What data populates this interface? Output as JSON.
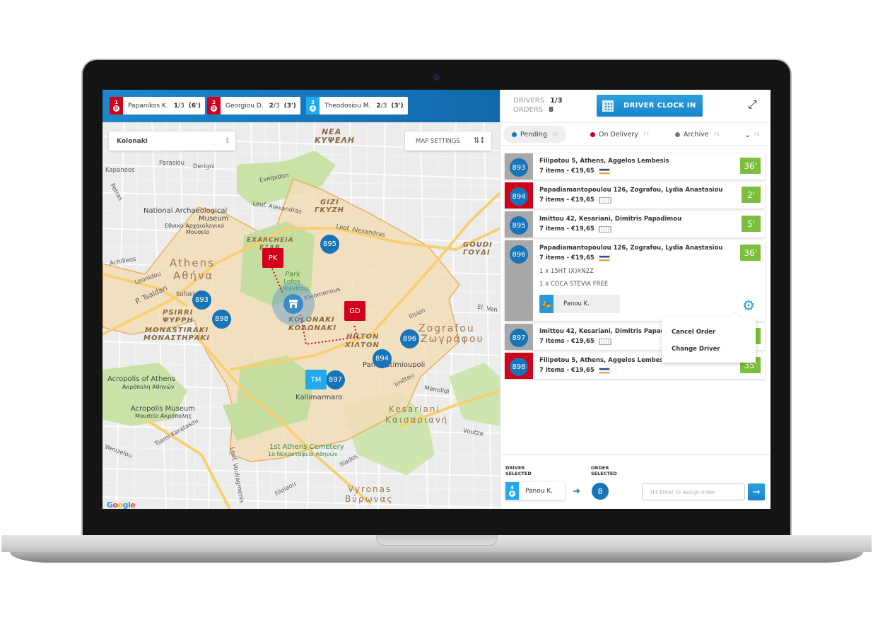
{
  "topbar": {
    "drivers": [
      {
        "index": "1",
        "status": "D",
        "name": "Papanikos K.",
        "count_done": "1",
        "count_total": "/3",
        "time": "(6')",
        "color": "#d0021b"
      },
      {
        "index": "2",
        "status": "D",
        "name": "Georgiou D.",
        "count_done": "2",
        "count_total": "/3",
        "time": "(3')",
        "color": "#d0021b"
      },
      {
        "index": "3",
        "status": "A",
        "name": "Theodosiou M.",
        "count_done": "2",
        "count_total": "/3",
        "time": "(3')",
        "color": "#22aaee"
      }
    ]
  },
  "map": {
    "area_select": "Kolonaki",
    "settings_label": "MAP SETTINGS",
    "labels": {
      "nea_kypseli": "ΝΕΑ",
      "nea_kypseli2": "ΚΥΨΕΛΗ",
      "gizi": "GIZI",
      "gizi_gr": "ΓΚΥΖΗ",
      "exarcheia": "EXARCHEIA",
      "exarcheia_gr": "ΕΞΑΡ",
      "athens": "Athens",
      "athens_gr": "Αθήνα",
      "psirri": "PSIRRI",
      "psirri_gr": "ΨΥΡΡΗ",
      "monastiraki": "MONASTIRAKI",
      "monastiraki_gr": "ΜΟΝΑΣΤΗΡΑΚΙ",
      "kolonaki": "KOLONAKI",
      "kolonaki_gr": "ΚΟΛΩΝΑΚΙ",
      "hilton": "HILTON",
      "hilton_gr": "ΧΙΛΤΟΝ",
      "zografou": "Zografou",
      "zografou_gr": "Ζωγράφου",
      "goudi": "GOUDI",
      "goudi_gr": "ΓΟΥΔΙ",
      "kesariani": "Kesariani",
      "kesariani_gr": "Καισαριανή",
      "vyronas": "Vyronas",
      "vyronas_gr": "Βύρωνας",
      "park": "Park",
      "park2": "Lofos",
      "park3": "Likavitou",
      "museum": "National Archaeological",
      "museum2": "Museum",
      "museum_gr": "Εθνικό Αρχαιολογικό",
      "museum_gr2": "Μουσείο",
      "acropolis": "Acropolis of Athens",
      "acropolis_gr": "Ακρόπολη Αθηνών",
      "acropolis_museum": "Acropolis Museum",
      "acropolis_museum_gr": "Μουσείο Ακρόπολης",
      "kallimarmaro": "Kallimarmaro",
      "cemetery": "1st Athens Cemetery",
      "cemetery_gr": "1ο Νεκροταφείο Αθηνών",
      "panepistimioupoli": "Panepistimioupoli",
      "evelpidon": "Evelpidon",
      "parasiou": "Parasiou",
      "derigni": "Derigni",
      "kapaneos": "Kapaneos",
      "petras": "Petras",
      "achilleos": "Achilleos",
      "leonidou": "Leonidou",
      "p_tsaldari": "P. Tsaldari",
      "sofokli": "Sofokl",
      "leof_alexandras": "Leof. Alexandras",
      "leof_alexandras2": "Leof. Alexandras",
      "kleomenous": "Kleomenous",
      "ilision": "Ilision",
      "el_ven": "El. Ven",
      "manolidi": "Manolidi",
      "voutza": "Voutza",
      "imittou": "Imittou",
      "iliados": "Iliados",
      "leof_vouliagmenis": "Leof. Vouliagmenis",
      "venizelou": "Venizelou",
      "karatasou": "Tsami Karatasou",
      "filolaou": "Filolaou",
      "google": "Google"
    },
    "order_pins": [
      "895",
      "893",
      "898",
      "896",
      "894",
      "897"
    ],
    "driver_pins": [
      {
        "initials": "PK",
        "color": "#d0021b"
      },
      {
        "initials": "GD",
        "color": "#d0021b"
      },
      {
        "initials": "TM",
        "color": "#22aaee"
      }
    ],
    "route_color": "#d0021b"
  },
  "panel": {
    "drivers_label": "DRIVERS",
    "drivers_value": "1/3",
    "orders_label": "ORDERS",
    "orders_value": "8",
    "clock_in_label": "DRIVER CLOCK IN",
    "tabs": [
      {
        "label": "Pending",
        "key": "F6",
        "color": "#1774b8",
        "active": true
      },
      {
        "label": "On Delivery",
        "key": "F7",
        "color": "#d0021b",
        "active": false
      },
      {
        "label": "Archive",
        "key": "F8",
        "color": "#777777",
        "active": false
      },
      {
        "label": "",
        "key": "F9",
        "color": "",
        "active": false
      }
    ],
    "orders": [
      {
        "id": "893",
        "address": "Filipotou 5, Athens, Aggelos Lembesis",
        "summary": "7 items - €19,65",
        "payment": "visa",
        "timer": "36'",
        "stripe": "#a8a8a8"
      },
      {
        "id": "894",
        "address": "Papadiamantopoulou 126, Zografou, Lydia Anastasiou",
        "summary": "7 items - €19,65",
        "payment": "cash",
        "timer": "2'",
        "stripe": "#d0021b"
      },
      {
        "id": "895",
        "address": "Imittou 42, Kesariani, Dimitris Papadimou",
        "summary": "7 items - €19,65",
        "payment": "cash",
        "timer": "5'",
        "stripe": "#a8a8a8"
      },
      {
        "id": "896",
        "address": "Papadiamantopoulou 126, Zografou, Lydia Anastasiou",
        "summary": "7 items - €19,65",
        "payment": "visa",
        "timer": "36'",
        "stripe": "#a8a8a8",
        "items": [
          "1 x 15HT (X)XN2Z",
          "1 x COCA STEVIA FREE"
        ],
        "driver": "Panou K."
      },
      {
        "id": "897",
        "address": "Imittou 42, Kesariani, Dimitris Papadimou",
        "summary": "7 items - €19,65",
        "payment": "cash",
        "timer": "",
        "stripe": "#a8a8a8"
      },
      {
        "id": "898",
        "address": "Filipotou 5, Athens, Aggelos Lembesis",
        "summary": "7 items - €19,65",
        "payment": "visa",
        "timer": "35'",
        "stripe": "#d0021b"
      }
    ],
    "context_menu": [
      "Cancel Order",
      "Change Driver"
    ],
    "footer": {
      "driver_selected_label1": "DRIVER",
      "driver_selected_label2": "SELECTED",
      "order_selected_label1": "ORDER",
      "order_selected_label2": "SELECTED",
      "driver_index": "4",
      "driver_status": "A",
      "driver_name": "Panou K.",
      "order_selected": "8",
      "assign_placeholder": "Hit Enter to assign order"
    }
  }
}
